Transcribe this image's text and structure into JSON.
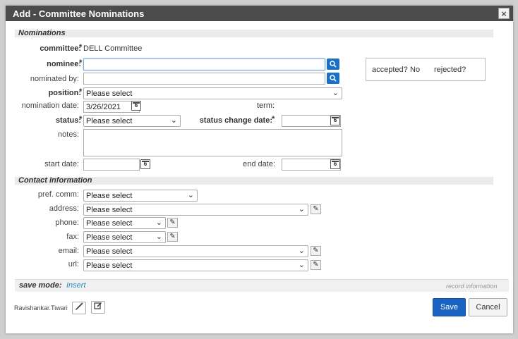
{
  "dialog": {
    "title": "Add - Committee Nominations",
    "close_icon": "×"
  },
  "nominations": {
    "section_title": "Nominations",
    "committee_label": "committee:",
    "committee_value": "DELL Committee",
    "nominee_label": "nominee:",
    "nominee_value": "",
    "nominated_by_label": "nominated by:",
    "nominated_by_value": "",
    "position_label": "position:",
    "position_value": "Please select",
    "nomination_date_label": "nomination date:",
    "nomination_date_value": "3/26/2021",
    "term_label": "term:",
    "status_label": "status:",
    "status_value": "Please select",
    "status_change_date_label": "status change date:",
    "status_change_date_value": "",
    "notes_label": "notes:",
    "notes_value": "",
    "start_date_label": "start date:",
    "start_date_value": "",
    "end_date_label": "end date:",
    "end_date_value": "",
    "accepted_label": "accepted?",
    "accepted_value": "No",
    "rejected_label": "rejected?"
  },
  "contact": {
    "section_title": "Contact Information",
    "pref_comm_label": "pref. comm:",
    "pref_comm_value": "Please select",
    "address_label": "address:",
    "address_value": "Please select",
    "phone_label": "phone:",
    "phone_value": "Please select",
    "fax_label": "fax:",
    "fax_value": "Please select",
    "email_label": "email:",
    "email_value": "Please select",
    "url_label": "url:",
    "url_value": "Please select"
  },
  "footer": {
    "save_mode_label": "save mode:",
    "save_mode_value": "Insert",
    "record_information": "record information",
    "user": "Ravishankar.Tiwari",
    "save_label": "Save",
    "cancel_label": "Cancel"
  },
  "colors": {
    "titlebar": "#4b4b4b",
    "primary": "#1a63c2",
    "required": "#dd0000",
    "link": "#2a8fbd"
  },
  "icons": {
    "search": "search-icon",
    "calendar": "calendar-icon",
    "edit": "pencil-icon",
    "brush": "brush-icon",
    "notes": "edit-note-icon"
  },
  "calendar_day": "6",
  "chevron": "⌄",
  "required_mark": "*"
}
